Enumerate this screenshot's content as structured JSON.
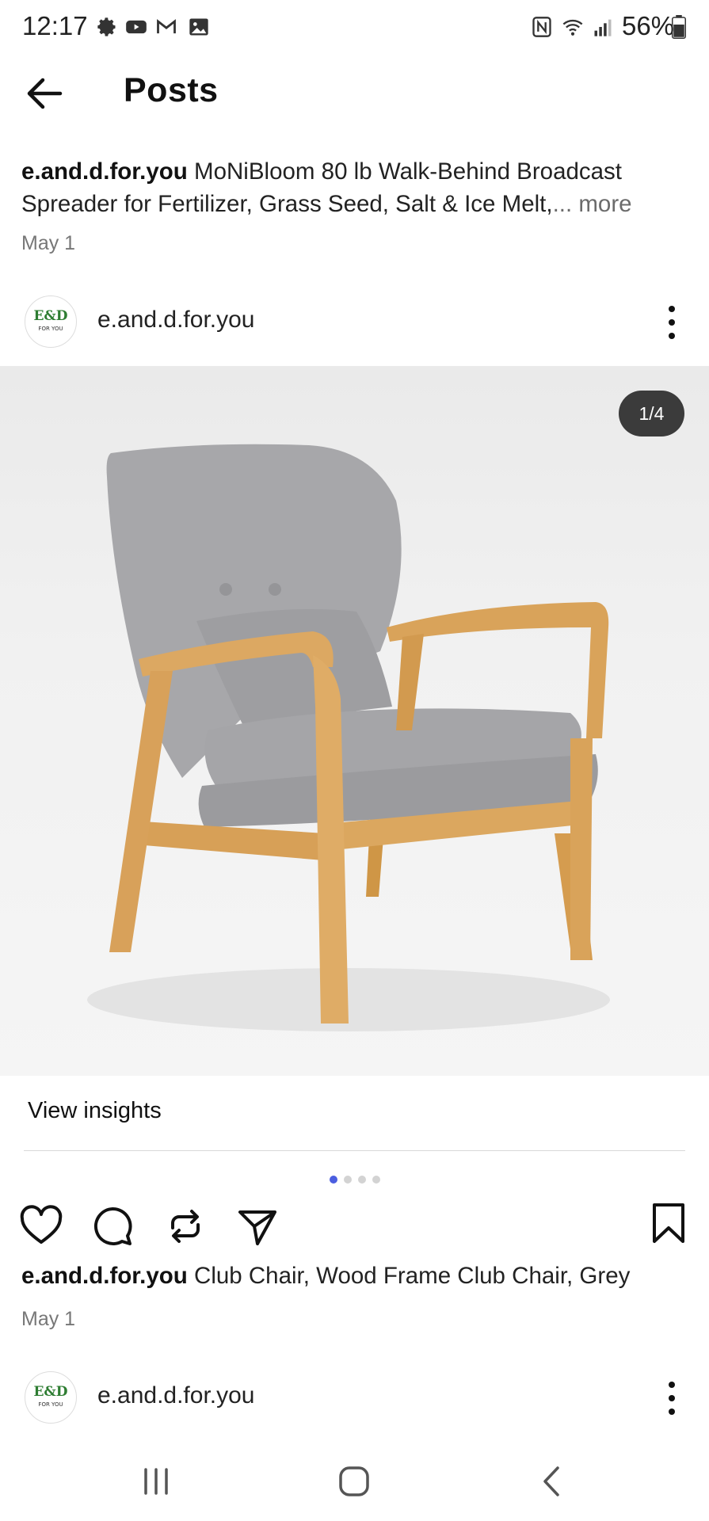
{
  "status_bar": {
    "time": "12:17",
    "icons": [
      "gear-icon",
      "youtube-icon",
      "gmail-icon",
      "gallery-icon",
      "nfc-icon",
      "wifi-icon",
      "signal-icon",
      "battery-icon"
    ],
    "battery": "56%"
  },
  "header": {
    "title": "Posts"
  },
  "post1": {
    "author": "e.and.d.for.you",
    "caption": "MoNiBloom 80 lb Walk-Behind Broadcast Spreader for Fertilizer, Grass Seed, Salt & Ice Melt,",
    "more": "... more",
    "date": "May 1"
  },
  "post2": {
    "author": "e.and.d.for.you",
    "image_counter": "1/4",
    "view_insights": "View insights",
    "carousel": {
      "count": 4,
      "active": 1
    },
    "caption": "Club Chair, Wood Frame Club Chair, Grey",
    "date": "May 1"
  },
  "post3": {
    "author": "e.and.d.for.you"
  },
  "avatar_text": {
    "top": "E&D",
    "bottom": "FOR YOU"
  },
  "colors": {
    "accent": "#4b5ee0",
    "wood": "#d9a35a",
    "fabric": "#a9a9ab"
  }
}
